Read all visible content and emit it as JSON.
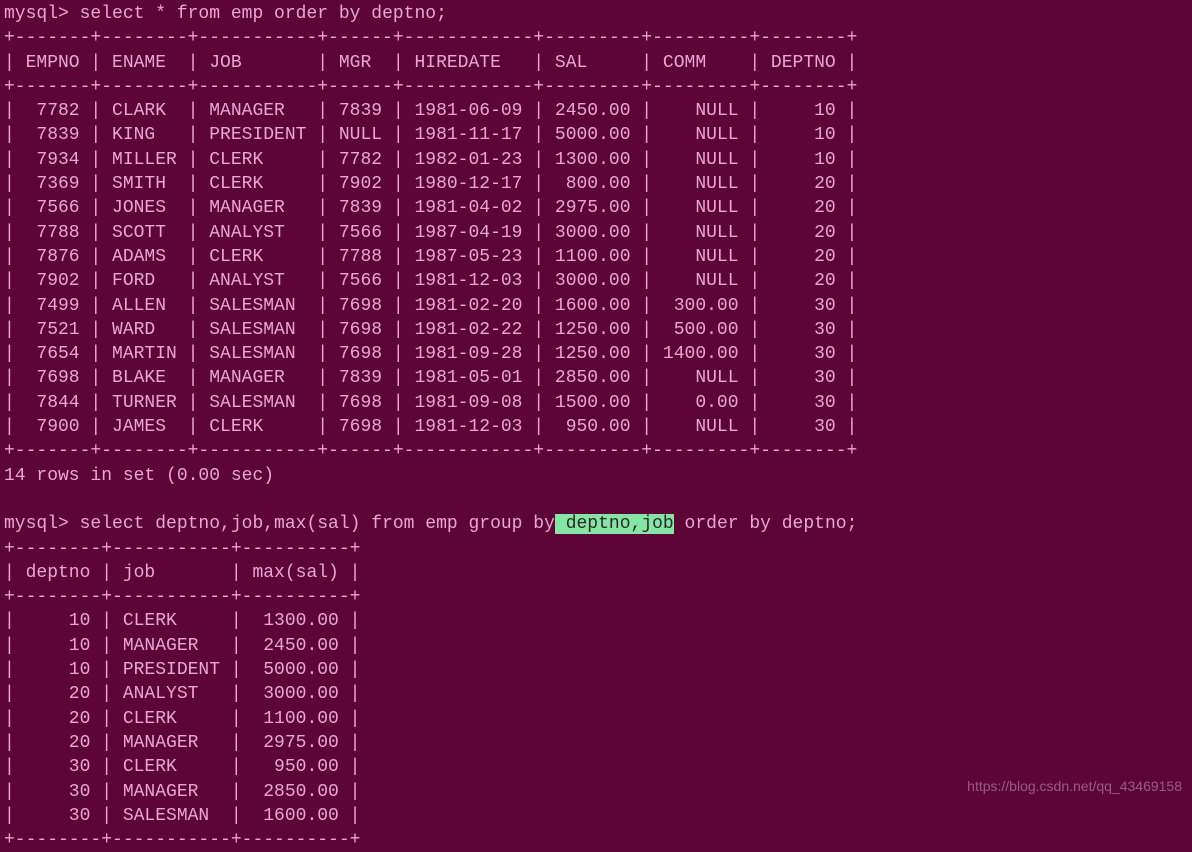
{
  "prompt": "mysql>",
  "query1": " select * from emp order by deptno;",
  "separator1": "+-------+--------+-----------+------+------------+---------+---------+--------+",
  "table1": {
    "headers": [
      "EMPNO",
      "ENAME",
      "JOB",
      "MGR",
      "HIREDATE",
      "SAL",
      "COMM",
      "DEPTNO"
    ],
    "header_line": "| EMPNO | ENAME  | JOB       | MGR  | HIREDATE   | SAL     | COMM    | DEPTNO |",
    "rows": [
      {
        "empno": "7782",
        "ename": "CLARK",
        "job": "MANAGER",
        "mgr": "7839",
        "hiredate": "1981-06-09",
        "sal": "2450.00",
        "comm": "NULL",
        "deptno": "10",
        "line": "|  7782 | CLARK  | MANAGER   | 7839 | 1981-06-09 | 2450.00 |    NULL |     10 |"
      },
      {
        "empno": "7839",
        "ename": "KING",
        "job": "PRESIDENT",
        "mgr": "NULL",
        "hiredate": "1981-11-17",
        "sal": "5000.00",
        "comm": "NULL",
        "deptno": "10",
        "line": "|  7839 | KING   | PRESIDENT | NULL | 1981-11-17 | 5000.00 |    NULL |     10 |"
      },
      {
        "empno": "7934",
        "ename": "MILLER",
        "job": "CLERK",
        "mgr": "7782",
        "hiredate": "1982-01-23",
        "sal": "1300.00",
        "comm": "NULL",
        "deptno": "10",
        "line": "|  7934 | MILLER | CLERK     | 7782 | 1982-01-23 | 1300.00 |    NULL |     10 |"
      },
      {
        "empno": "7369",
        "ename": "SMITH",
        "job": "CLERK",
        "mgr": "7902",
        "hiredate": "1980-12-17",
        "sal": "800.00",
        "comm": "NULL",
        "deptno": "20",
        "line": "|  7369 | SMITH  | CLERK     | 7902 | 1980-12-17 |  800.00 |    NULL |     20 |"
      },
      {
        "empno": "7566",
        "ename": "JONES",
        "job": "MANAGER",
        "mgr": "7839",
        "hiredate": "1981-04-02",
        "sal": "2975.00",
        "comm": "NULL",
        "deptno": "20",
        "line": "|  7566 | JONES  | MANAGER   | 7839 | 1981-04-02 | 2975.00 |    NULL |     20 |"
      },
      {
        "empno": "7788",
        "ename": "SCOTT",
        "job": "ANALYST",
        "mgr": "7566",
        "hiredate": "1987-04-19",
        "sal": "3000.00",
        "comm": "NULL",
        "deptno": "20",
        "line": "|  7788 | SCOTT  | ANALYST   | 7566 | 1987-04-19 | 3000.00 |    NULL |     20 |"
      },
      {
        "empno": "7876",
        "ename": "ADAMS",
        "job": "CLERK",
        "mgr": "7788",
        "hiredate": "1987-05-23",
        "sal": "1100.00",
        "comm": "NULL",
        "deptno": "20",
        "line": "|  7876 | ADAMS  | CLERK     | 7788 | 1987-05-23 | 1100.00 |    NULL |     20 |"
      },
      {
        "empno": "7902",
        "ename": "FORD",
        "job": "ANALYST",
        "mgr": "7566",
        "hiredate": "1981-12-03",
        "sal": "3000.00",
        "comm": "NULL",
        "deptno": "20",
        "line": "|  7902 | FORD   | ANALYST   | 7566 | 1981-12-03 | 3000.00 |    NULL |     20 |"
      },
      {
        "empno": "7499",
        "ename": "ALLEN",
        "job": "SALESMAN",
        "mgr": "7698",
        "hiredate": "1981-02-20",
        "sal": "1600.00",
        "comm": "300.00",
        "deptno": "30",
        "line": "|  7499 | ALLEN  | SALESMAN  | 7698 | 1981-02-20 | 1600.00 |  300.00 |     30 |"
      },
      {
        "empno": "7521",
        "ename": "WARD",
        "job": "SALESMAN",
        "mgr": "7698",
        "hiredate": "1981-02-22",
        "sal": "1250.00",
        "comm": "500.00",
        "deptno": "30",
        "line": "|  7521 | WARD   | SALESMAN  | 7698 | 1981-02-22 | 1250.00 |  500.00 |     30 |"
      },
      {
        "empno": "7654",
        "ename": "MARTIN",
        "job": "SALESMAN",
        "mgr": "7698",
        "hiredate": "1981-09-28",
        "sal": "1250.00",
        "comm": "1400.00",
        "deptno": "30",
        "line": "|  7654 | MARTIN | SALESMAN  | 7698 | 1981-09-28 | 1250.00 | 1400.00 |     30 |"
      },
      {
        "empno": "7698",
        "ename": "BLAKE",
        "job": "MANAGER",
        "mgr": "7839",
        "hiredate": "1981-05-01",
        "sal": "2850.00",
        "comm": "NULL",
        "deptno": "30",
        "line": "|  7698 | BLAKE  | MANAGER   | 7839 | 1981-05-01 | 2850.00 |    NULL |     30 |"
      },
      {
        "empno": "7844",
        "ename": "TURNER",
        "job": "SALESMAN",
        "mgr": "7698",
        "hiredate": "1981-09-08",
        "sal": "1500.00",
        "comm": "0.00",
        "deptno": "30",
        "line": "|  7844 | TURNER | SALESMAN  | 7698 | 1981-09-08 | 1500.00 |    0.00 |     30 |"
      },
      {
        "empno": "7900",
        "ename": "JAMES",
        "job": "CLERK",
        "mgr": "7698",
        "hiredate": "1981-12-03",
        "sal": "950.00",
        "comm": "NULL",
        "deptno": "30",
        "line": "|  7900 | JAMES  | CLERK     | 7698 | 1981-12-03 |  950.00 |    NULL |     30 |"
      }
    ]
  },
  "result1": "14 rows in set (0.00 sec)",
  "query2_before": " select deptno,job,max(sal) from emp group by",
  "query2_highlight": " deptno,job",
  "query2_after": " order by deptno;",
  "separator2": "+--------+-----------+----------+",
  "table2": {
    "headers": [
      "deptno",
      "job",
      "max(sal)"
    ],
    "header_line": "| deptno | job       | max(sal) |",
    "rows": [
      {
        "deptno": "10",
        "job": "CLERK",
        "max": "1300.00",
        "line": "|     10 | CLERK     |  1300.00 |"
      },
      {
        "deptno": "10",
        "job": "MANAGER",
        "max": "2450.00",
        "line": "|     10 | MANAGER   |  2450.00 |"
      },
      {
        "deptno": "10",
        "job": "PRESIDENT",
        "max": "5000.00",
        "line": "|     10 | PRESIDENT |  5000.00 |"
      },
      {
        "deptno": "20",
        "job": "ANALYST",
        "max": "3000.00",
        "line": "|     20 | ANALYST   |  3000.00 |"
      },
      {
        "deptno": "20",
        "job": "CLERK",
        "max": "1100.00",
        "line": "|     20 | CLERK     |  1100.00 |"
      },
      {
        "deptno": "20",
        "job": "MANAGER",
        "max": "2975.00",
        "line": "|     20 | MANAGER   |  2975.00 |"
      },
      {
        "deptno": "30",
        "job": "CLERK",
        "max": "950.00",
        "line": "|     30 | CLERK     |   950.00 |"
      },
      {
        "deptno": "30",
        "job": "MANAGER",
        "max": "2850.00",
        "line": "|     30 | MANAGER   |  2850.00 |"
      },
      {
        "deptno": "30",
        "job": "SALESMAN",
        "max": "1600.00",
        "line": "|     30 | SALESMAN  |  1600.00 |"
      }
    ]
  },
  "watermark": "https://blog.csdn.net/qq_43469158"
}
